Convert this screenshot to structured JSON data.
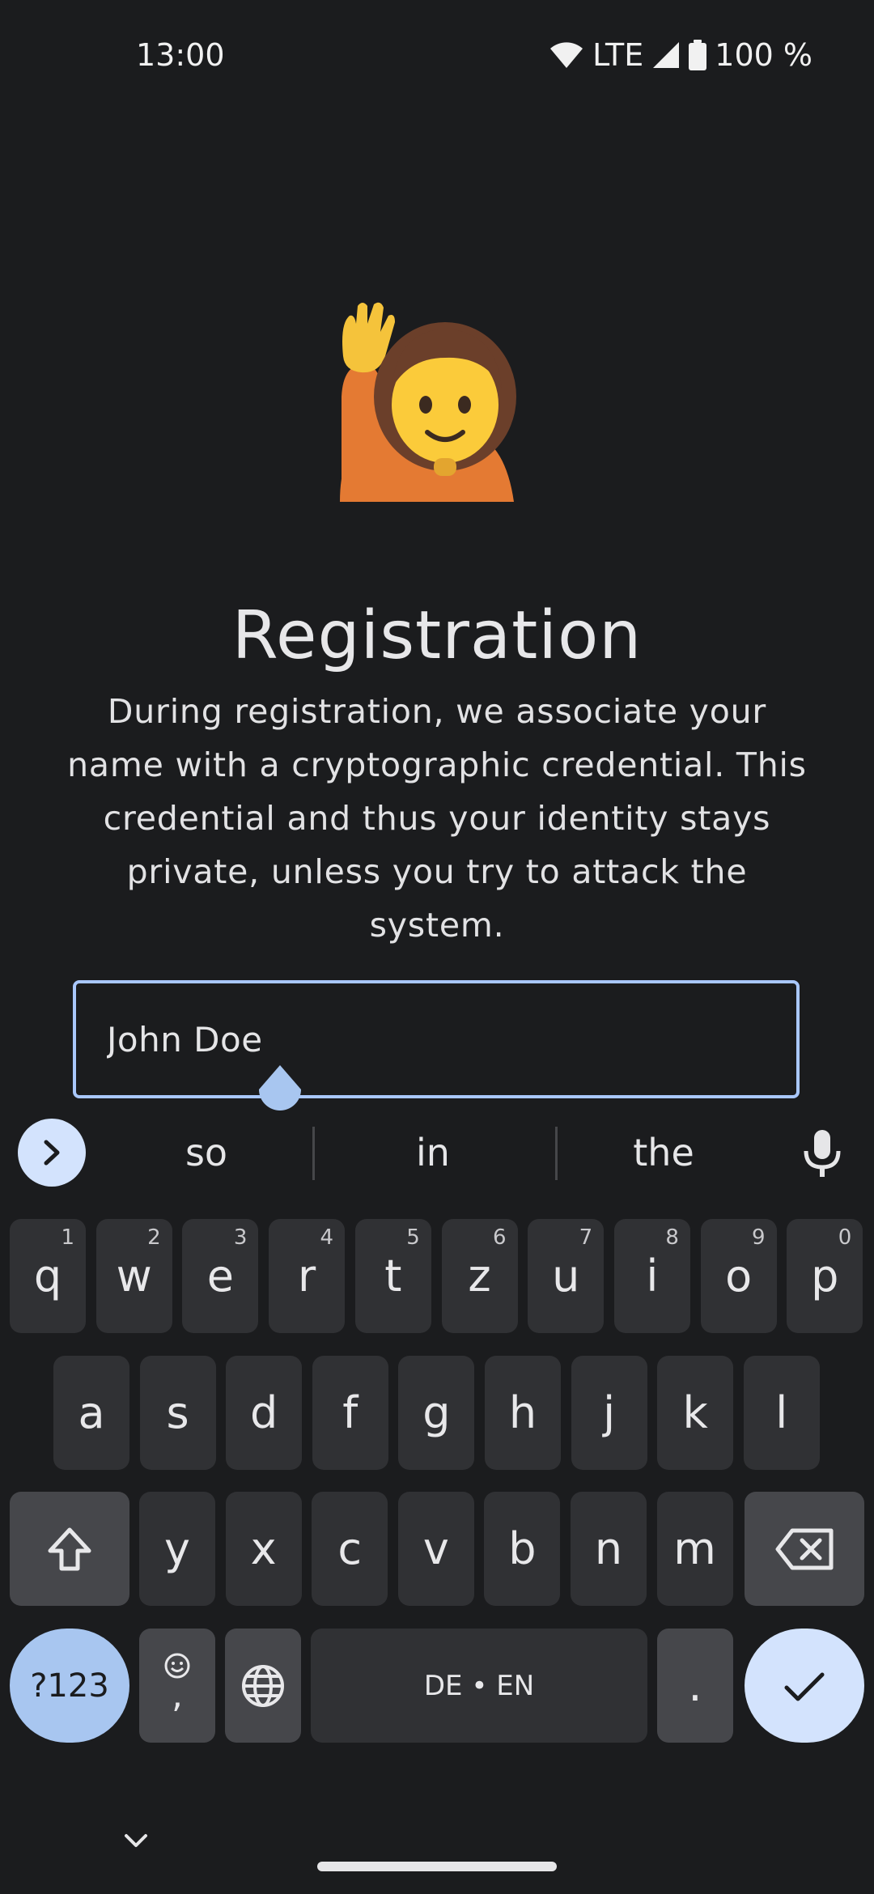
{
  "status": {
    "time": "13:00",
    "network": "LTE",
    "battery": "100 %"
  },
  "hero": {
    "emoji_icon": "person-raising-hand-icon",
    "title": "Registration",
    "description": "During registration, we associate your name with a cryptographic credential. This credential and thus your identity stays private, unless you try to attack the system."
  },
  "name_input": {
    "value": "John Doe"
  },
  "suggestions": [
    "so",
    "in",
    "the"
  ],
  "keyboard": {
    "row1": [
      {
        "k": "q",
        "h": "1"
      },
      {
        "k": "w",
        "h": "2"
      },
      {
        "k": "e",
        "h": "3"
      },
      {
        "k": "r",
        "h": "4"
      },
      {
        "k": "t",
        "h": "5"
      },
      {
        "k": "z",
        "h": "6"
      },
      {
        "k": "u",
        "h": "7"
      },
      {
        "k": "i",
        "h": "8"
      },
      {
        "k": "o",
        "h": "9"
      },
      {
        "k": "p",
        "h": "0"
      }
    ],
    "row2": [
      "a",
      "s",
      "d",
      "f",
      "g",
      "h",
      "j",
      "k",
      "l"
    ],
    "row3": [
      "y",
      "x",
      "c",
      "v",
      "b",
      "n",
      "m"
    ],
    "symbols_label": "?123",
    "comma_label": ",",
    "space_label": "DE • EN",
    "period_label": "."
  },
  "colors": {
    "background": "#1b1c1e",
    "key": "#303134",
    "key_function": "#46474b",
    "accent": "#d3e3fd",
    "input_border": "#a9c7fb"
  }
}
